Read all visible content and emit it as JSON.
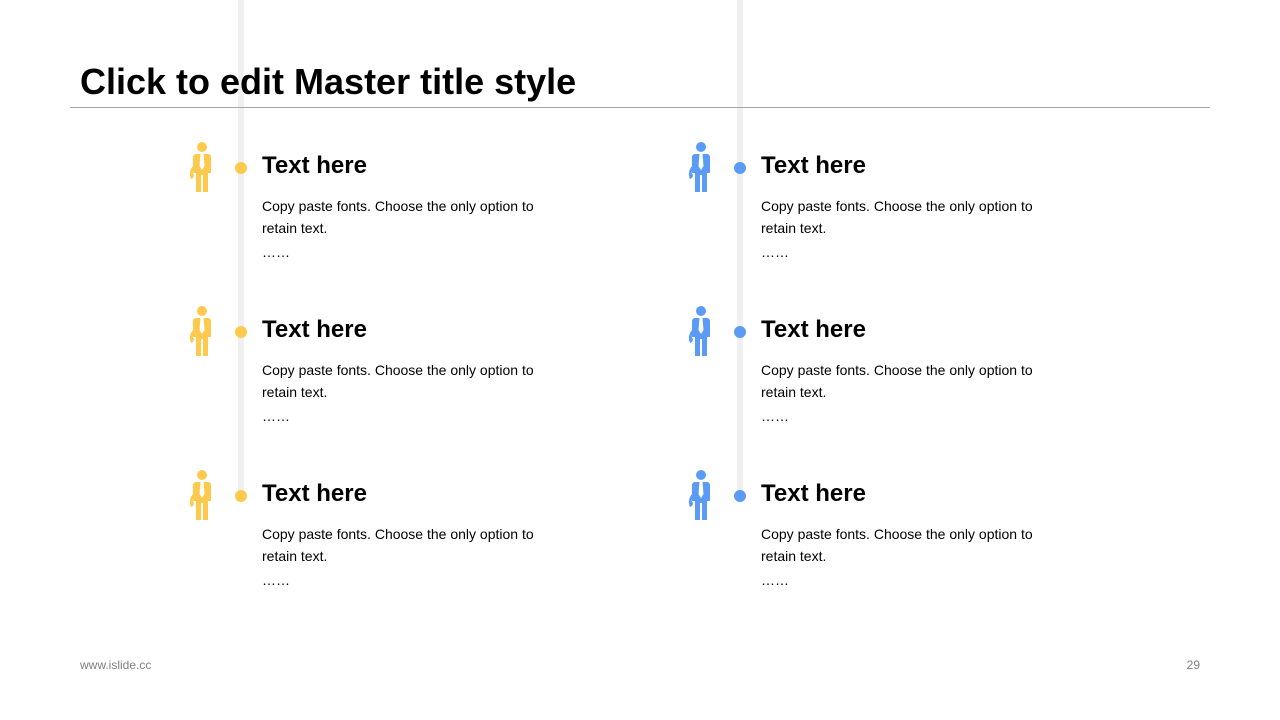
{
  "slide": {
    "title": "Click to edit Master title style",
    "footer_url": "www.islide.cc",
    "page_number": "29"
  },
  "colors": {
    "left_accent": "#FFC94D",
    "right_accent": "#5B9BF5",
    "track": "#F0F0F0",
    "rule": "#A6A6A6"
  },
  "icons": {
    "person": "businessman-with-tie-icon"
  },
  "columns": [
    {
      "items": [
        {
          "heading": "Text here",
          "body": "Copy paste fonts. Choose the only option to retain text.",
          "ellipsis": "……"
        },
        {
          "heading": "Text here",
          "body": "Copy paste fonts. Choose the only option to retain text.",
          "ellipsis": "……"
        },
        {
          "heading": "Text here",
          "body": "Copy paste fonts. Choose the only option to retain text.",
          "ellipsis": "……"
        }
      ]
    },
    {
      "items": [
        {
          "heading": "Text here",
          "body": "Copy paste fonts. Choose the only option to retain text.",
          "ellipsis": "……"
        },
        {
          "heading": "Text here",
          "body": "Copy paste fonts. Choose the only option to retain text.",
          "ellipsis": "……"
        },
        {
          "heading": "Text here",
          "body": "Copy paste fonts. Choose the only option to retain text.",
          "ellipsis": "……"
        }
      ]
    }
  ]
}
